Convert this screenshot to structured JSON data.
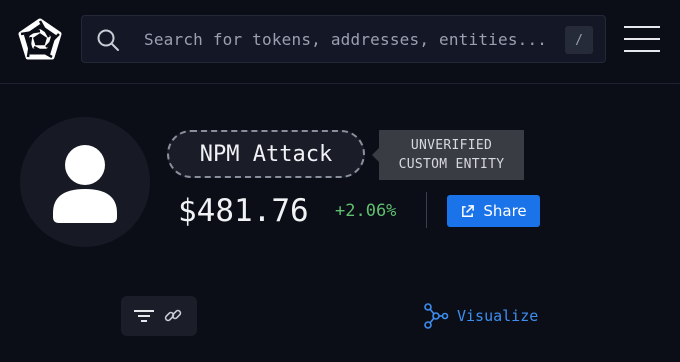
{
  "header": {
    "logo_icon": "arkham-logo-icon",
    "search": {
      "placeholder": "Search for tokens, addresses, entities...",
      "shortcut_key": "/"
    },
    "menu_icon": "hamburger-menu-icon"
  },
  "entity": {
    "avatar_icon": "user-avatar-icon",
    "name": "NPM Attack",
    "tooltip": {
      "line1": "UNVERIFIED",
      "line2": "CUSTOM ENTITY"
    },
    "balance": "$481.76",
    "change": "+2.06%",
    "share_label": "Share"
  },
  "toolbar": {
    "filter_icon": "filter-icon",
    "link_icon": "link-icon",
    "visualize_label": "Visualize"
  },
  "colors": {
    "background": "#0b0e17",
    "accent": "#1a73e8",
    "positive": "#5fbf6f",
    "link": "#3d8ef0"
  }
}
